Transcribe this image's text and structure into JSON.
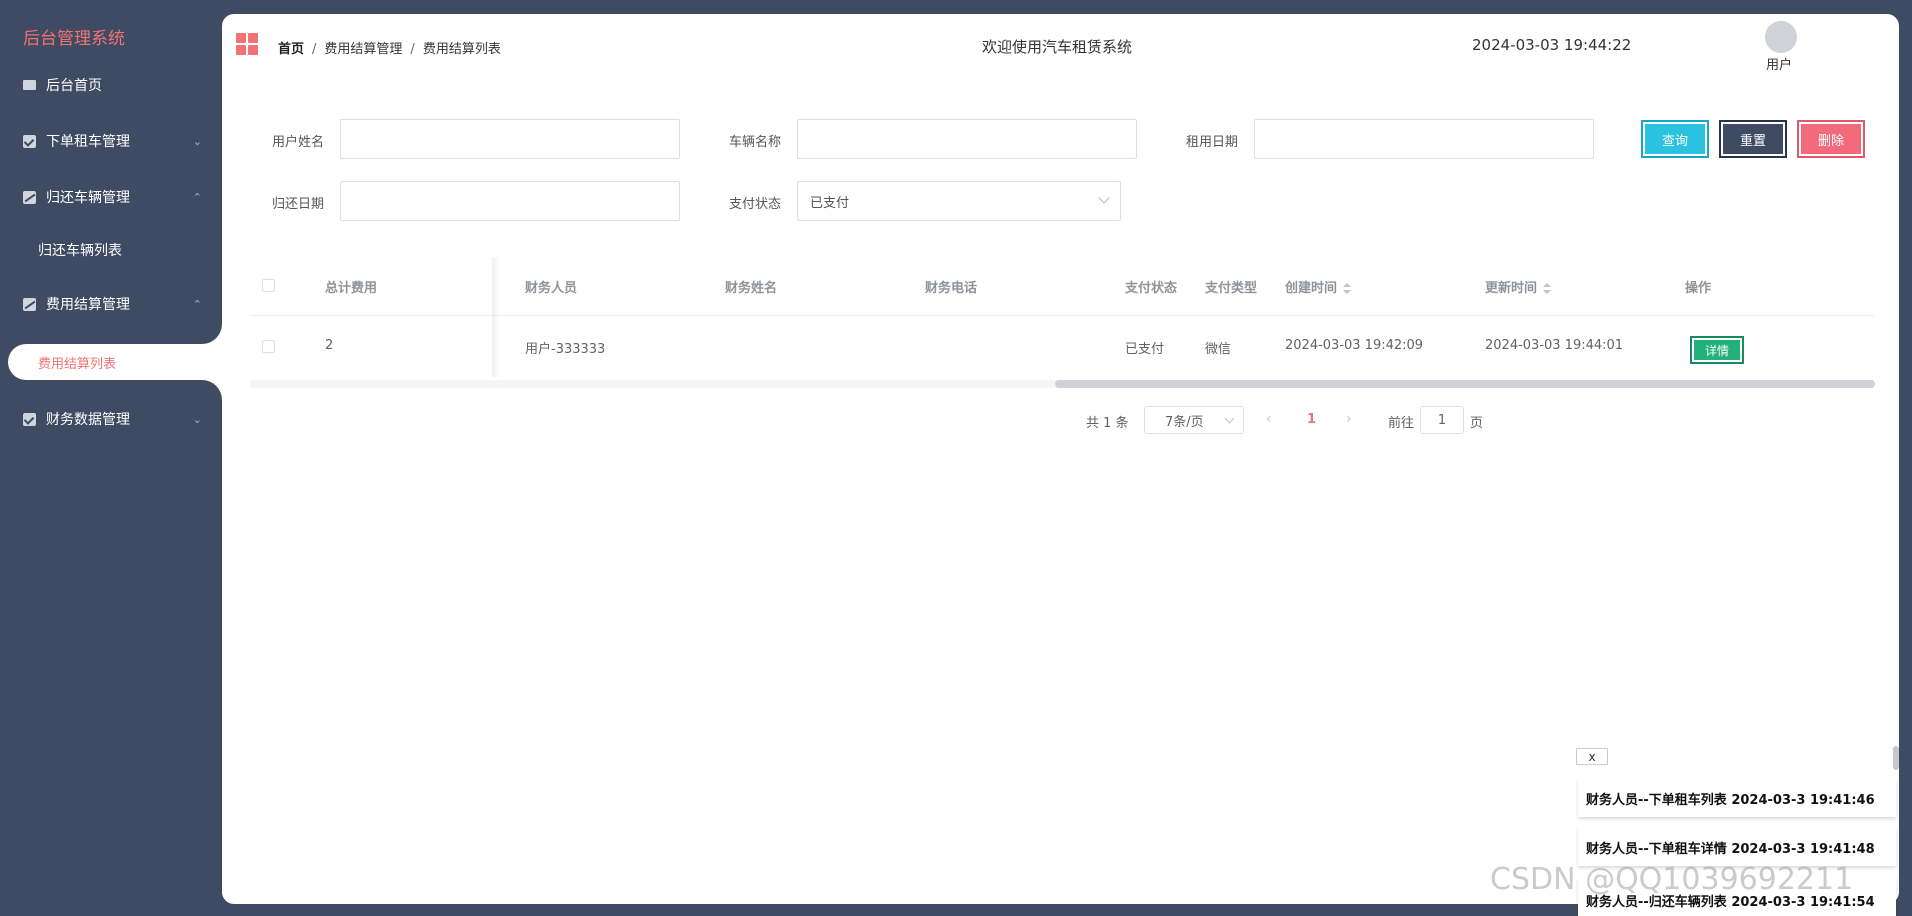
{
  "sidebar": {
    "brand": "后台管理系统",
    "items": [
      {
        "label": "后台首页"
      },
      {
        "label": "下单租车管理"
      },
      {
        "label": "归还车辆管理"
      },
      {
        "label": "归还车辆列表"
      },
      {
        "label": "费用结算管理"
      },
      {
        "label": "费用结算列表"
      },
      {
        "label": "财务数据管理"
      }
    ],
    "accent_color": "#f07272"
  },
  "header": {
    "breadcrumb": [
      "首页",
      "费用结算管理",
      "费用结算列表"
    ],
    "separator": "/",
    "welcome": "欢迎使用汽车租赁系统",
    "datetime": "2024-03-03 19:44:22",
    "user_label": "用户"
  },
  "search": {
    "user_name_label": "用户姓名",
    "vehicle_name_label": "车辆名称",
    "rent_date_label": "租用日期",
    "return_date_label": "归还日期",
    "pay_status_label": "支付状态",
    "pay_status_value": "已支付",
    "query_label": "查询",
    "reset_label": "重置",
    "delete_label": "删除"
  },
  "table": {
    "columns": [
      "总计费用",
      "财务人员",
      "财务姓名",
      "财务电话",
      "支付状态",
      "支付类型",
      "创建时间",
      "更新时间",
      "操作"
    ],
    "rows": [
      {
        "total_fee": "2",
        "finance_staff": "用户-333333",
        "finance_name": "",
        "finance_phone": "",
        "pay_status": "已支付",
        "pay_type": "微信",
        "created_at": "2024-03-03 19:42:09",
        "updated_at": "2024-03-03 19:44:01",
        "action_label": "详情"
      }
    ]
  },
  "pagination": {
    "total": "共 1 条",
    "page_size": "7条/页",
    "prev": "‹",
    "next": "›",
    "current_page": "1",
    "goto_label": "前往",
    "goto_value": "1",
    "page_suffix": "页"
  },
  "notifications": {
    "close_label": "x",
    "items": [
      "财务人员--下单租车列表 2024-03-3 19:41:46",
      "财务人员--下单租车详情 2024-03-3 19:41:48",
      "财务人员--归还车辆列表 2024-03-3 19:41:54"
    ]
  },
  "watermark": "CSDN @QQ1039692211"
}
